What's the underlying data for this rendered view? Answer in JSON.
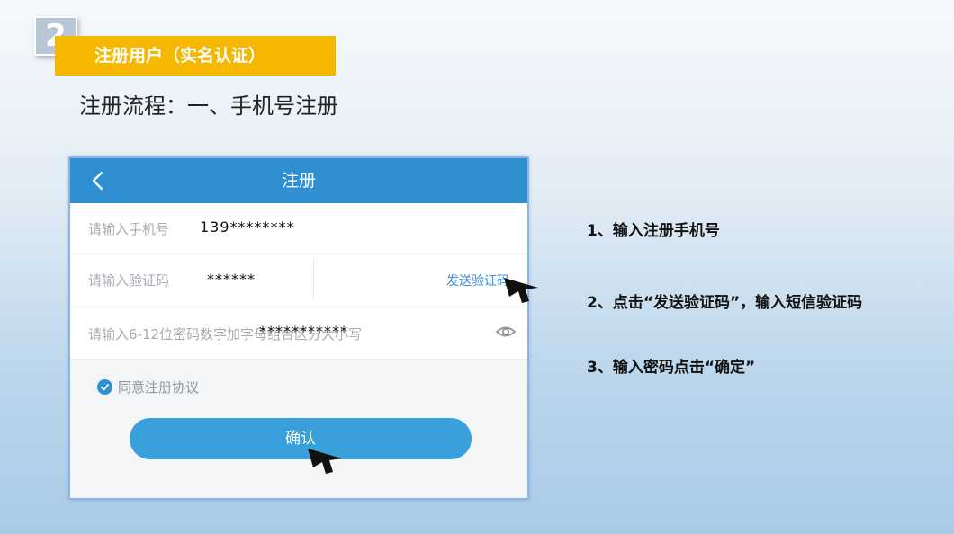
{
  "slide": {
    "step_number": "2",
    "section_title": "注册用户（实名认证）",
    "subtitle": "注册流程：一、手机号注册"
  },
  "app": {
    "header_title": "注册",
    "phone_field": {
      "placeholder": "请输入手机号",
      "value": "139********"
    },
    "code_field": {
      "placeholder": "请输入验证码",
      "value": "******",
      "send_label": "发送验证码"
    },
    "password_field": {
      "placeholder": "请输入6-12位密码数字加字母组合区分大小写",
      "value": "***********"
    },
    "agree_label": "同意注册协议",
    "confirm_label": "确认",
    "icons": {
      "back": "chevron-left-icon",
      "eye": "eye-icon",
      "check": "check-icon"
    },
    "colors": {
      "header": "#2f8fd0",
      "button": "#3aa0dc",
      "link": "#3b8fd6",
      "badge": "#f5b700"
    }
  },
  "instructions": [
    "1、输入注册手机号",
    "2、点击“发送验证码”，输入短信验证码",
    "3、输入密码点击“确定”"
  ]
}
